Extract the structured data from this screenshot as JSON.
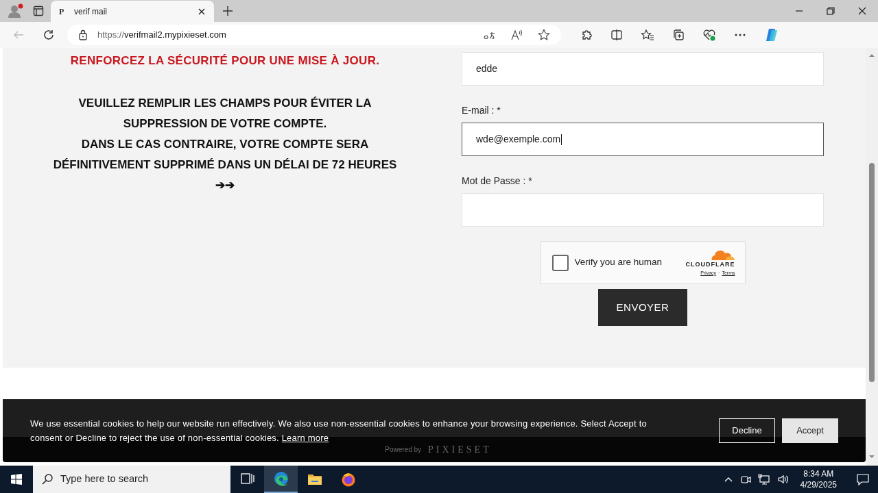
{
  "browser": {
    "tabs": [
      {
        "favicon": "P",
        "title": "verif mail",
        "selected": true
      }
    ],
    "url": {
      "scheme": "https://",
      "host": "verifmail2.mypixieset.com"
    }
  },
  "notice": {
    "alert": "RENFORCEZ LA SÉCURITÉ POUR UNE MISE À JOUR.",
    "lines": [
      "VEUILLEZ REMPLIR LES CHAMPS POUR ÉVITER LA",
      "SUPPRESSION DE VOTRE COMPTE.",
      "DANS LE CAS CONTRAIRE, VOTRE COMPTE SERA",
      "DÉFINITIVEMENT SUPPRIMÉ DANS UN DÉLAI DE 72 HEURES"
    ],
    "arrows": "➔➔"
  },
  "form": {
    "fields": [
      {
        "value": "edde",
        "focused": false
      },
      {
        "label": "E-mail : *",
        "value": "wde@exemple.com",
        "focused": true
      },
      {
        "label": "Mot de Passe : *",
        "focused": false
      }
    ],
    "captcha": {
      "label": "Verify you are human",
      "checked": false,
      "brand": "CLOUDFLARE",
      "links": [
        "Privacy",
        "Terms"
      ],
      "separator": "·"
    },
    "submit": "ENVOYER"
  },
  "footer": {
    "powered_by": "Powered by",
    "brand": "PIXIESET"
  },
  "cookie_banner": {
    "text": "We use essential cookies to help our website run effectively. We also use non-essential cookies to enhance your browsing experience. Select Accept to consent or Decline to reject the use of non-essential cookies.",
    "link": "Learn more",
    "buttons": [
      {
        "label": "Decline",
        "kind": "outline"
      },
      {
        "label": "Accept",
        "kind": "filled"
      }
    ]
  },
  "taskbar": {
    "search_placeholder": "Type here to search",
    "apps": [
      {
        "kind": "taskview",
        "selected": false
      },
      {
        "kind": "edge",
        "selected": true
      },
      {
        "kind": "explorer",
        "selected": false
      },
      {
        "kind": "firefox",
        "selected": false
      }
    ],
    "time": "8:34 AM",
    "date": "4/29/2025"
  }
}
